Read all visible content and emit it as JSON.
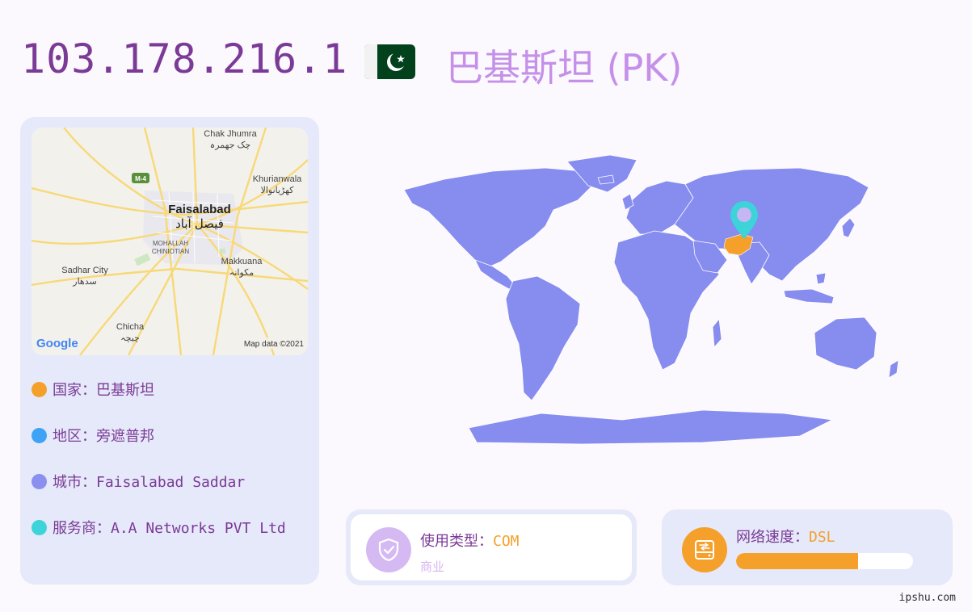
{
  "header": {
    "ip": "103.178.216.1",
    "country_title": "巴基斯坦 (PK)",
    "flag_icon": "pakistan-flag-icon"
  },
  "map": {
    "labels": {
      "chak_jhumra": "Chak Jhumra",
      "chak_jhumra_ur": "چک جھمرہ",
      "khurianwala": "Khurianwala",
      "khurianwala_ur": "کھڑیانوالا",
      "m4": "M-4",
      "faisalabad": "Faisalabad",
      "faisalabad_ur": "فیصل آباد",
      "mohallah": "MOHALLAH",
      "chiniotian": "CHINIOTIAN",
      "sadhar": "Sadhar City",
      "sadhar_ur": "سدھار",
      "makkuana": "Makkuana",
      "makkuana_ur": "مکوانہ",
      "chicha": "Chicha",
      "chicha_ur": "چیچہ",
      "google": "Google",
      "mapdata": "Map data ©2021"
    }
  },
  "info": {
    "country": "国家：巴基斯坦",
    "region": "地区：旁遮普邦",
    "city": "城市：Faisalabad Saddar",
    "isp": "服务商：A.A Networks PVT Ltd"
  },
  "usage": {
    "label": "使用类型：",
    "value": "COM",
    "sub": "商业",
    "icon": "shield-check-icon"
  },
  "speed": {
    "label": "网络速度：",
    "value": "DSL",
    "level_percent": 69,
    "icon": "network-drive-icon"
  },
  "footer": {
    "site": "ipshu.com"
  },
  "colors": {
    "title_purple": "#7b3a96",
    "country_lilac": "#c490e8",
    "orange": "#f5a02a",
    "blue": "#3fa3f5",
    "periwinkle": "#8a8ff0",
    "teal": "#3cd3d9",
    "land": "#878cef",
    "highlight": "#f5a02a"
  }
}
